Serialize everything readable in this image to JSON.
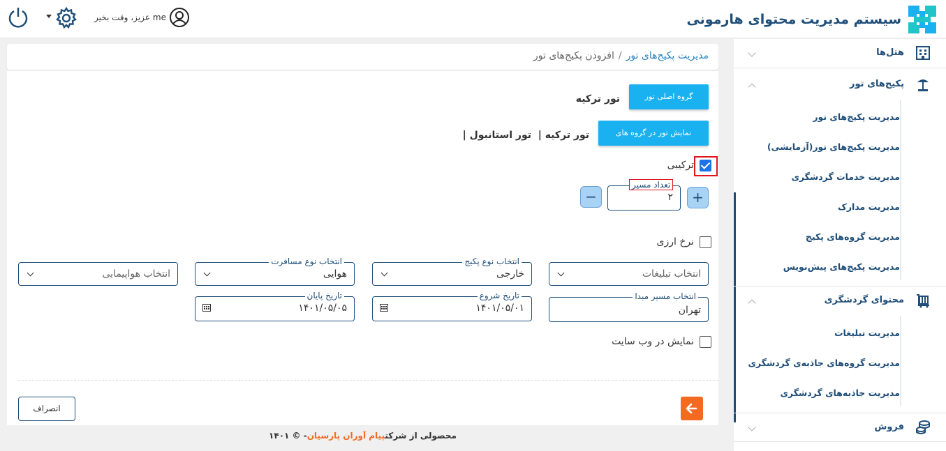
{
  "header": {
    "app_title": "سیستم مدیریت محتوای هارمونی",
    "user_name": "me",
    "greeting": "عزیز، وقت بخیر"
  },
  "breadcrumb": {
    "parent": "مدیریت پکیج‌های تور",
    "separator": "/",
    "current": "افزودن پکیج‌های تور"
  },
  "sidebar": {
    "sections": [
      {
        "label": "هتل‌ها",
        "icon": "hotel-building-icon",
        "expanded": false
      },
      {
        "label": "پکیج‌های تور",
        "icon": "beach-umbrella-icon",
        "expanded": true,
        "items": [
          "مدیریت پکیج‌های تور",
          "مدیریت پکیج‌های تور(آزمایشی)",
          "مدیریت خدمات گردشگری",
          "مدیریت مدارک",
          "مدیریت گروه‌های پکیج",
          "مدیریت پکیج‌های پیش‌نویس"
        ]
      },
      {
        "label": "محتوای گردشگری",
        "icon": "luggage-cart-icon",
        "expanded": true,
        "items": [
          "مدیریت تبلیغات",
          "مدیریت گروه‌های جاذبه‌ی گردشگری",
          "مدیریت جاذبه‌های گردشگری"
        ]
      },
      {
        "label": "فروش",
        "icon": "coins-icon",
        "expanded": false
      }
    ]
  },
  "form": {
    "main_group_button": "گروه اصلی تور",
    "main_group_value": "تور ترکیه",
    "show_in_groups_button": "نمایش تور در گروه های",
    "groups_value": "تور ترکیه |  تور استانبول |",
    "combined_label": "ترکیبی",
    "combined_checked": true,
    "route_count_label": "تعداد مسیر",
    "route_count_value": "۲",
    "plus": "+",
    "minus": "−",
    "currency_label": "نرخ ارزی",
    "currency_checked": false,
    "ads_select": {
      "value": "انتخاب تبلیغات"
    },
    "package_type_select": {
      "label": "انتخاب نوع پکیج",
      "value": "خارجی"
    },
    "travel_type_select": {
      "label": "انتخاب نوع مسافرت",
      "value": "هوایی"
    },
    "airline_select": {
      "value": "انتخاب هواپیمایی"
    },
    "origin_field": {
      "label": "انتخاب مسیر مبدا",
      "value": "تهران"
    },
    "start_date_field": {
      "label": "تاریخ شروع",
      "value": "۱۴۰۱/۰۵/۰۱"
    },
    "end_date_field": {
      "label": "تاریخ پایان",
      "value": "۱۴۰۱/۰۵/۰۵"
    },
    "show_website_label": "نمایش در وب سایت",
    "show_website_checked": false,
    "cancel_button": "انصراف"
  },
  "footer": {
    "prefix": "محصولی از شرکت",
    "company": "پیام آوران پارسیان",
    "suffix": "- © ۱۴۰۱"
  },
  "colors": {
    "primary": "#1f4e79",
    "accent_blue": "#1ab1f0",
    "orange": "#f36a21",
    "highlight_red": "#e0161e"
  }
}
